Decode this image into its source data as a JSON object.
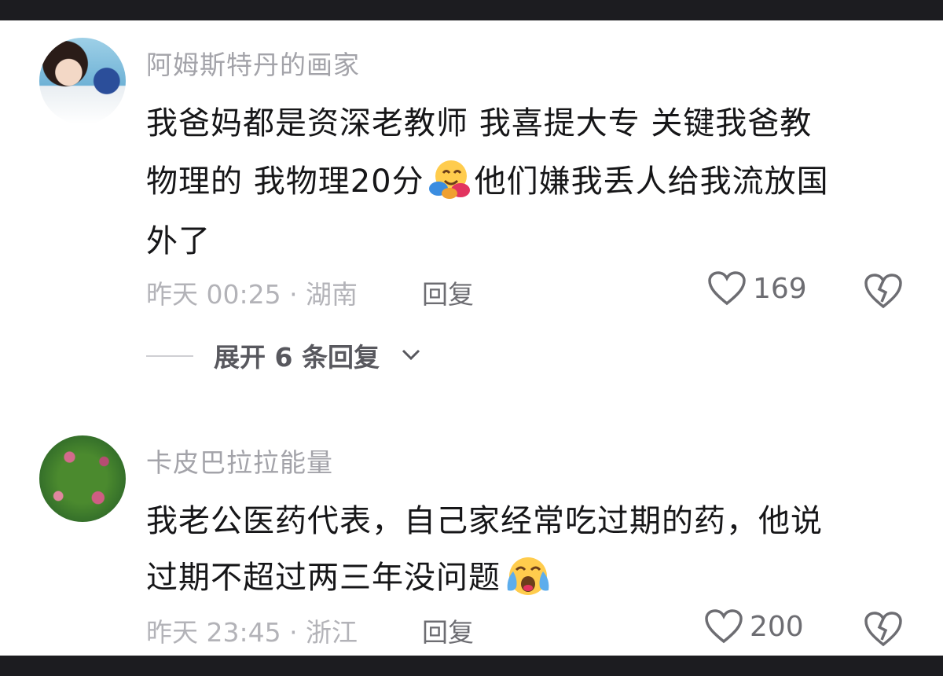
{
  "comments": [
    {
      "username": "阿姆斯特丹的画家",
      "lines": [
        "我爸妈都是资深老教师 我喜提大专 关键我爸教",
        "物理的 我物理20分",
        "他们嫌我丢人给我流放国",
        "外了"
      ],
      "emoji": "hugging-face-emoji",
      "time_location": "昨天 00:25 · 湖南",
      "reply_label": "回复",
      "likes": "169",
      "expand_replies": "展开 6 条回复"
    },
    {
      "username": "卡皮巴拉拉能量",
      "lines": [
        "我老公医药代表，自己家经常吃过期的药，他说",
        "过期不超过两三年没问题"
      ],
      "emoji": "loudly-crying-face-emoji",
      "time_location": "昨天 23:45 · 浙江",
      "reply_label": "回复",
      "likes": "200"
    }
  ],
  "colors": {
    "background": "#ffffff",
    "frame": "#1c1c20",
    "username": "#a3a3a9",
    "body_text": "#161618",
    "meta": "#b3b3b8",
    "action": "#6d6d72"
  },
  "icons": [
    "heart-outline-icon",
    "broken-heart-icon",
    "chevron-down-icon"
  ]
}
